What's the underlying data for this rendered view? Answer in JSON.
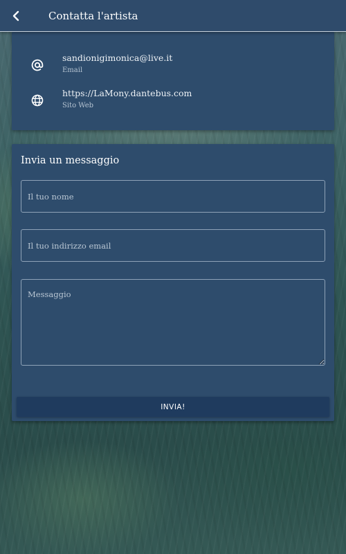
{
  "header": {
    "title": "Contatta l'artista",
    "back_icon": "chevron-left-icon"
  },
  "contact_info": {
    "items": [
      {
        "icon": "at-sign-icon",
        "value": "sandionigimonica@live.it",
        "label": "Email"
      },
      {
        "icon": "globe-icon",
        "value": "https://LaMony.dantebus.com",
        "label": "Sito Web"
      }
    ]
  },
  "message_form": {
    "title": "Invia un messaggio",
    "name_placeholder": "Il tuo nome",
    "email_placeholder": "Il tuo indirizzo email",
    "message_placeholder": "Messaggio",
    "submit_label": "INVIA!"
  },
  "colors": {
    "app_bar": "#2f4b6b",
    "card": "#2e4c6c",
    "button": "#1f3b5e"
  }
}
